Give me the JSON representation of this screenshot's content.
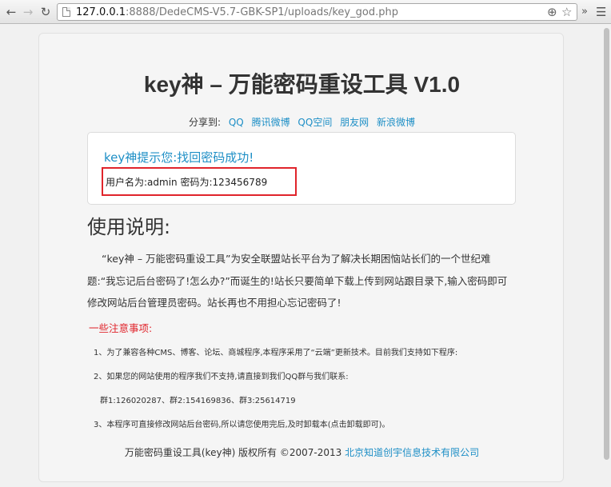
{
  "browser": {
    "url_host": "127.0.0.1",
    "url_rest": ":8888/DedeCMS-V5.7-GBK-SP1/uploads/key_god.php",
    "more_label": "»"
  },
  "page": {
    "title": "key神 – 万能密码重设工具 V1.0",
    "share_label": "分享到:",
    "share_links": [
      "QQ",
      "腾讯微博",
      "QQ空间",
      "朋友网",
      "新浪微博"
    ],
    "result_message": "key神提示您:找回密码成功!",
    "credentials": "用户名为:admin 密码为:123456789",
    "usage_heading": "使用说明:",
    "intro": "“key神 – 万能密码重设工具”为安全联盟站长平台为了解决长期困恼站长们的一个世纪难题:“我忘记后台密码了!怎么办?”而诞生的!站长只要简单下载上传到网站跟目录下,输入密码即可修改网站后台管理员密码。站长再也不用担心忘记密码了!",
    "notice_title": "一些注意事项:",
    "notes": [
      "1、为了兼容各种CMS、博客、论坛、商城程序,本程序采用了“云端”更新技术。目前我们支持如下程序:",
      "2、如果您的网站使用的程序我们不支持,请直接到我们QQ群与我们联系:",
      "群1:126020287、群2:154169836、群3:25614719",
      "3、本程序可直接修改网站后台密码,所以请您使用完后,及时卸载本(点击卸载即可)。"
    ],
    "footer_text": "万能密码重设工具(key神) 版权所有 ©2007-2013 ",
    "footer_link": "北京知道创宇信息技术有限公司"
  },
  "colors": {
    "link": "#1e8fc6",
    "alert": "#e0242b"
  },
  "icons": [
    "back-arrow-icon",
    "forward-arrow-icon",
    "reload-icon",
    "page-icon",
    "zoom-icon",
    "star-icon",
    "menu-icon"
  ]
}
